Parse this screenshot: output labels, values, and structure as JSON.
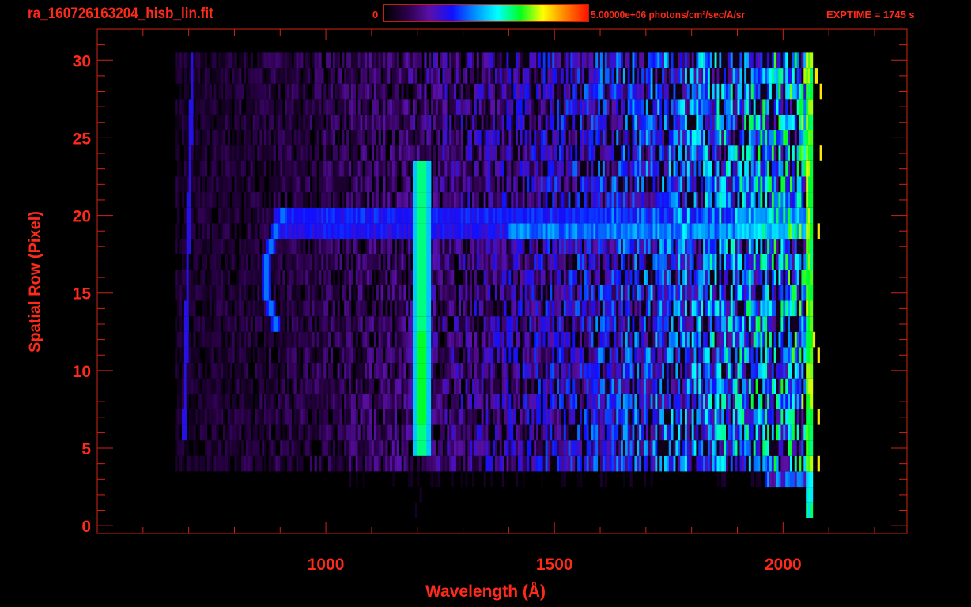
{
  "header": {
    "title": "ra_160726163204_hisb_lin.fit",
    "colorbar_min": "0",
    "colorbar_max_label": "5.00000e+06 photons/cm²/sec/A/sr",
    "exptime": "EXPTIME = 1745 s"
  },
  "chart_data": {
    "type": "heatmap",
    "title": "ra_160726163204_hisb_lin.fit",
    "xlabel": "Wavelength (Å)",
    "ylabel": "Spatial Row (Pixel)",
    "xlim": [
      500,
      2271
    ],
    "ylim": [
      -0.5,
      32
    ],
    "xticks": [
      1000,
      1500,
      2000
    ],
    "xtick_labels": [
      "1000",
      "1500",
      "2000"
    ],
    "xminor_step": 100,
    "yticks": [
      0,
      5,
      10,
      15,
      20,
      25,
      30
    ],
    "ytick_labels": [
      "0",
      "5",
      "10",
      "15",
      "20",
      "25",
      "30"
    ],
    "yminor_step": 1,
    "color_range": [
      0,
      5000000
    ],
    "color_units": "photons/cm^2/sec/A/sr",
    "colormap": [
      "#000000",
      "#2a0048",
      "#5a10a8",
      "#1010ff",
      "#0090ff",
      "#00ffff",
      "#00ff20",
      "#ffff00",
      "#ff8000",
      "#ff1000"
    ],
    "grid": false,
    "wavelength_bin": 5,
    "rows": [
      3,
      30
    ],
    "features": {
      "continuum": {
        "rows": [
          4,
          30
        ],
        "wavelength": [
          670,
          2055
        ],
        "level_start": 0.08,
        "level_end": 0.5
      },
      "lyman_alpha": {
        "center": 1210,
        "halfwidth": 20,
        "rows": [
          5,
          23
        ],
        "level": 0.62
      },
      "bright_band": {
        "rows": [
          19,
          20
        ],
        "wavelength": [
          885,
          2050
        ],
        "level": 0.42
      },
      "arc": {
        "rows": [
          13,
          20
        ],
        "center": 870,
        "level": 0.42
      },
      "edge_line": {
        "wavelength_start": 690,
        "wavelength_end": 708,
        "rows": [
          6,
          30
        ],
        "level": 0.3
      },
      "detector_edge": {
        "wavelength": [
          2052,
          2066
        ],
        "rows": [
          1,
          30
        ],
        "level": 0.62
      }
    }
  }
}
